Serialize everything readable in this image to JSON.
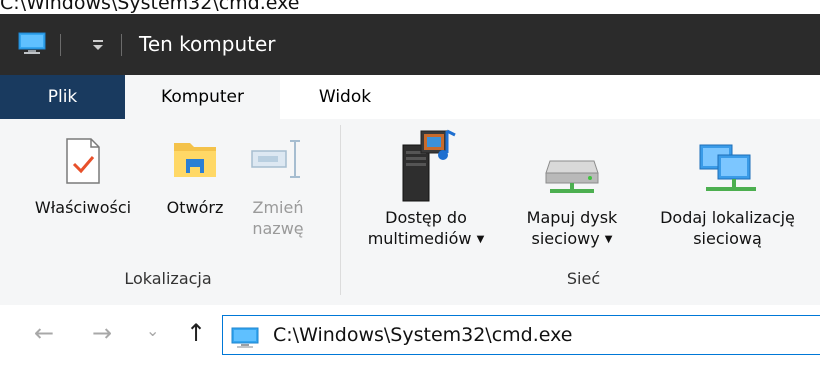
{
  "caption": "C:\\Windows\\System32\\cmd.exe",
  "window": {
    "title": "Ten komputer"
  },
  "tabs": [
    {
      "label": "Plik"
    },
    {
      "label": "Komputer"
    },
    {
      "label": "Widok"
    }
  ],
  "ribbon": {
    "groups": [
      {
        "label": "Lokalizacja",
        "buttons": [
          {
            "line1": "Właściwości",
            "line2": "",
            "icon": "properties-check-icon",
            "enabled": true
          },
          {
            "line1": "Otwórz",
            "line2": "",
            "icon": "open-folder-icon",
            "enabled": true
          },
          {
            "line1": "Zmień",
            "line2": "nazwę",
            "icon": "rename-icon",
            "enabled": false
          }
        ]
      },
      {
        "label": "Sieć",
        "buttons": [
          {
            "line1": "Dostęp do",
            "line2": "multimediów",
            "icon": "media-server-icon",
            "dropdown": true
          },
          {
            "line1": "Mapuj dysk",
            "line2": "sieciowy",
            "icon": "network-drive-icon",
            "dropdown": true
          },
          {
            "line1": "Dodaj lokalizację",
            "line2": "sieciową",
            "icon": "network-location-icon",
            "dropdown": false
          }
        ]
      }
    ]
  },
  "address": {
    "path": "C:\\Windows\\System32\\cmd.exe"
  },
  "nav": {
    "back": "←",
    "forward": "→",
    "recent": "⌄",
    "up": "↑"
  },
  "colors": {
    "titlebar": "#2b2b2b",
    "file_tab": "#193a5f",
    "ribbon": "#f5f6f7",
    "address_border": "#0078d7"
  }
}
